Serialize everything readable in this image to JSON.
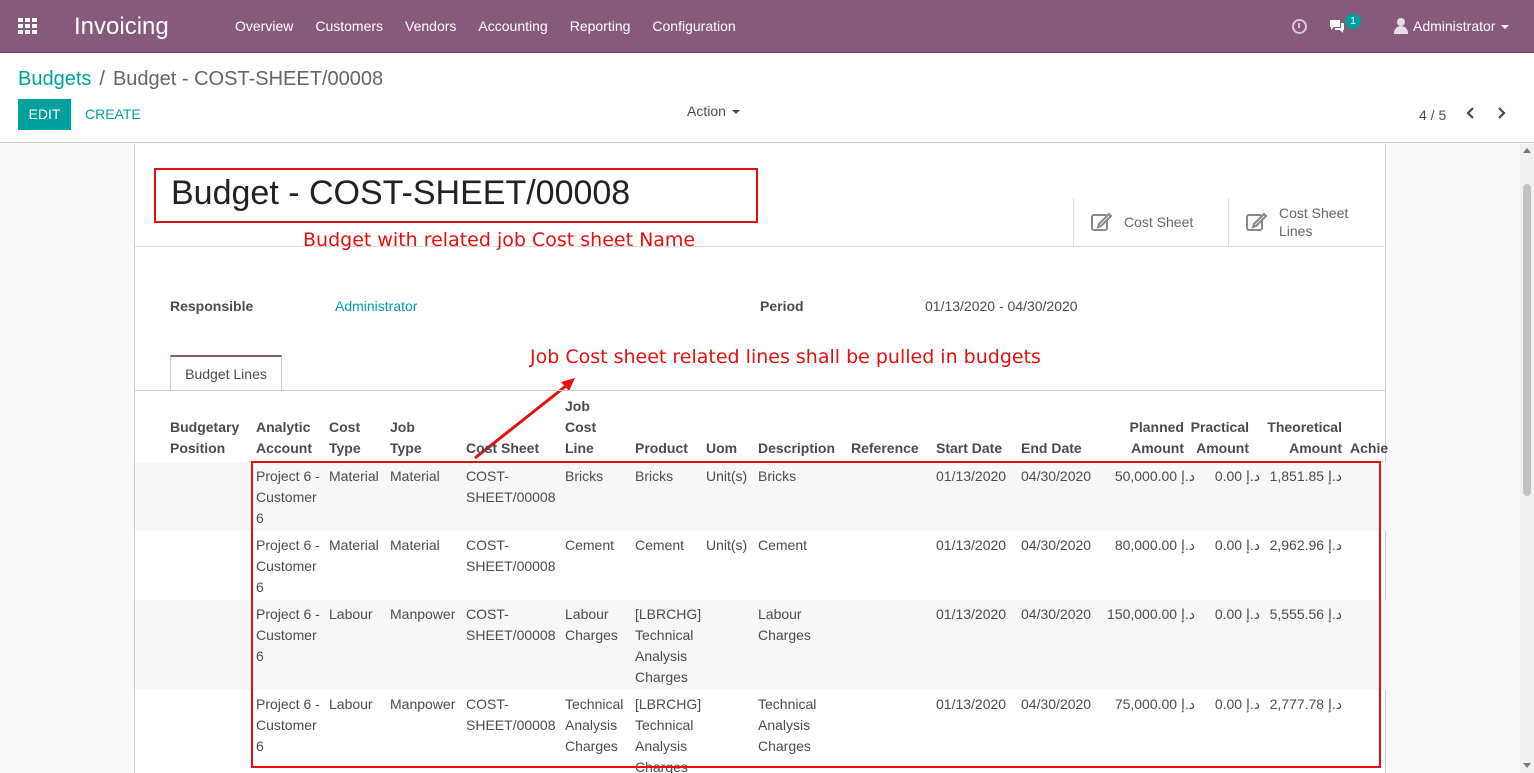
{
  "navbar": {
    "brand": "Invoicing",
    "menu": [
      "Overview",
      "Customers",
      "Vendors",
      "Accounting",
      "Reporting",
      "Configuration"
    ],
    "chat_badge": "1",
    "user": "Administrator"
  },
  "control_panel": {
    "breadcrumb_root": "Budgets",
    "breadcrumb_separator": "/",
    "breadcrumb_current": "Budget - COST-SHEET/00008",
    "edit_label": "EDIT",
    "create_label": "CREATE",
    "action_label": "Action",
    "pager": "4 / 5"
  },
  "form": {
    "title": "Budget - COST-SHEET/00008",
    "smart_buttons": [
      "Cost Sheet",
      "Cost Sheet\nLines"
    ],
    "responsible_label": "Responsible",
    "responsible_value": "Administrator",
    "period_label": "Period",
    "period_value": "01/13/2020 - 04/30/2020",
    "tab_label": "Budget Lines"
  },
  "annotations": {
    "title_note": "Budget with related job Cost sheet Name",
    "lines_note": "Job Cost sheet related lines shall be pulled in budgets"
  },
  "table": {
    "headers": [
      "Budgetary\nPosition",
      "Analytic\nAccount",
      "Cost\nType",
      "Job\nType",
      "Cost Sheet",
      "Job\nCost\nLine",
      "Product",
      "Uom",
      "Description",
      "Reference",
      "Start Date",
      "End Date",
      "Planned\nAmount",
      "Practical\nAmount",
      "Theoretical\nAmount",
      "Achie"
    ],
    "rows": [
      [
        "",
        "Project 6 -\nCustomer\n6",
        "Material",
        "Material",
        "COST-\nSHEET/00008",
        "Bricks",
        "Bricks",
        "Unit(s)",
        "Bricks",
        "",
        "01/13/2020",
        "04/30/2020",
        "50,000.00 د.إ",
        "0.00 د.إ",
        "1,851.85 د.إ"
      ],
      [
        "",
        "Project 6 -\nCustomer\n6",
        "Material",
        "Material",
        "COST-\nSHEET/00008",
        "Cement",
        "Cement",
        "Unit(s)",
        "Cement",
        "",
        "01/13/2020",
        "04/30/2020",
        "80,000.00 د.إ",
        "0.00 د.إ",
        "2,962.96 د.إ"
      ],
      [
        "",
        "Project 6 -\nCustomer\n6",
        "Labour",
        "Manpower",
        "COST-\nSHEET/00008",
        "Labour\nCharges",
        "[LBRCHG]\nTechnical\nAnalysis\nCharges",
        "",
        "Labour\nCharges",
        "",
        "01/13/2020",
        "04/30/2020",
        "150,000.00 د.إ",
        "0.00 د.إ",
        "5,555.56 د.إ"
      ],
      [
        "",
        "Project 6 -\nCustomer\n6",
        "Labour",
        "Manpower",
        "COST-\nSHEET/00008",
        "Technical\nAnalysis\nCharges",
        "[LBRCHG]\nTechnical\nAnalysis\nCharges",
        "",
        "Technical\nAnalysis\nCharges",
        "",
        "01/13/2020",
        "04/30/2020",
        "75,000.00 د.إ",
        "0.00 د.إ",
        "2,777.78 د.إ"
      ]
    ]
  },
  "colors": {
    "brand": "#875A7B",
    "accent": "#00A09D",
    "annotation": "#e31010"
  }
}
